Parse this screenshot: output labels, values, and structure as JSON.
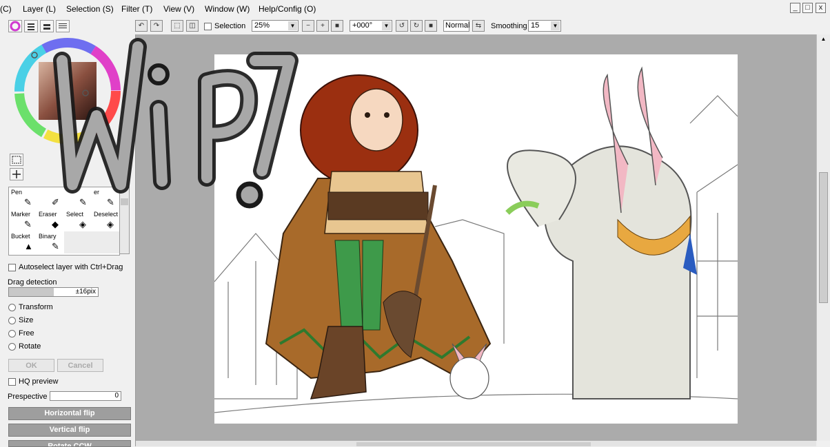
{
  "menubar": {
    "items": [
      "(C)",
      "Layer (L)",
      "Selection (S)",
      "Filter (T)",
      "View (V)",
      "Window (W)",
      "Help/Config (O)"
    ]
  },
  "window_controls": {
    "minimize": "_",
    "maximize": "□",
    "close": "x"
  },
  "toolbar": {
    "selection_label": "Selection",
    "zoom_value": "25%",
    "rotation_value": "+000°",
    "blend_mode": "Normal",
    "smoothing_label": "Smoothing",
    "smoothing_value": "15"
  },
  "tools": [
    {
      "label": "Pen",
      "icon": "pen-icon"
    },
    {
      "label": "",
      "icon": "airbrush-icon"
    },
    {
      "label": "",
      "icon": "brush-icon"
    },
    {
      "label": "er",
      "icon": "water-icon"
    },
    {
      "label": "Marker",
      "icon": "marker-icon"
    },
    {
      "label": "Eraser",
      "icon": "eraser-icon"
    },
    {
      "label": "Select",
      "icon": "select-icon"
    },
    {
      "label": "Deselect",
      "icon": "deselect-icon"
    },
    {
      "label": "Bucket",
      "icon": "bucket-icon"
    },
    {
      "label": "Binary",
      "icon": "binary-pen-icon"
    }
  ],
  "options": {
    "autoselect_label": "Autoselect layer with Ctrl+Drag",
    "drag_detection_label": "Drag detection",
    "drag_detection_value": "±16pix",
    "transform_modes": [
      "Transform",
      "Size",
      "Free",
      "Rotate"
    ],
    "ok_label": "OK",
    "cancel_label": "Cancel",
    "hq_preview_label": "HQ preview",
    "perspective_label": "Prespective",
    "perspective_value": "0",
    "horizontal_flip": "Horizontal flip",
    "vertical_flip": "Vertical flip",
    "rotate_ccw": "Rotate CCW"
  },
  "overlay": {
    "watermark_text": "WiP"
  },
  "colors": {
    "panel_bg": "#f0f0f0",
    "canvas_bg": "#ababab",
    "button_gray": "#9e9e9e"
  }
}
